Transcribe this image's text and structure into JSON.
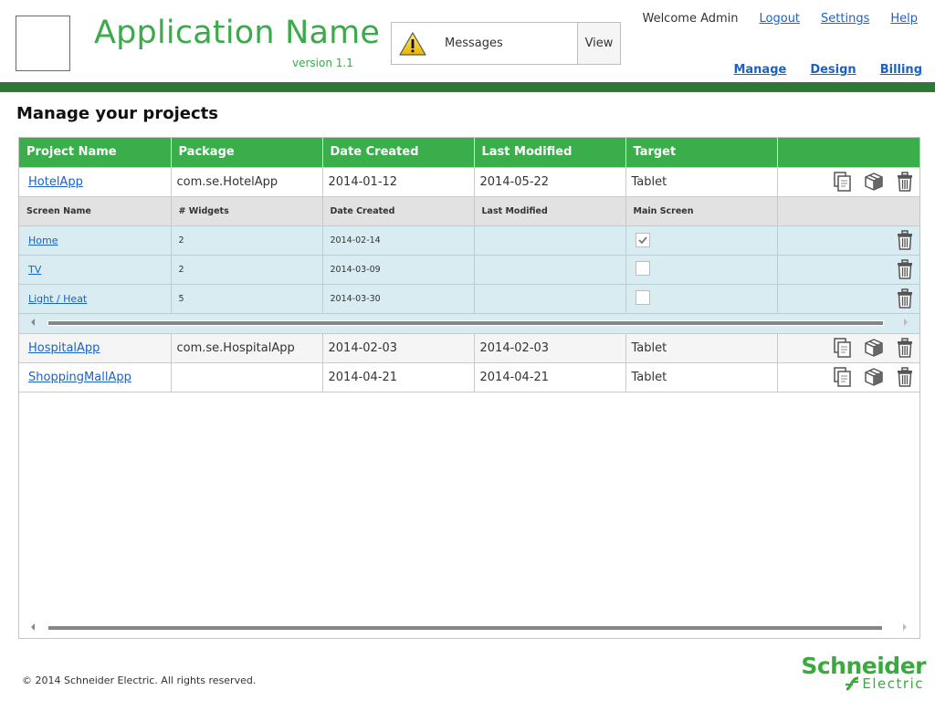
{
  "header": {
    "app_name": "Application Name",
    "version": "version 1.1",
    "messages": {
      "label": "Messages",
      "view_label": "View",
      "icon": "warning-icon"
    },
    "welcome": "Welcome Admin",
    "user_links": [
      "Logout",
      "Settings",
      "Help"
    ],
    "nav": [
      "Manage",
      "Design",
      "Billing"
    ]
  },
  "page": {
    "title": "Manage your projects"
  },
  "projects_table": {
    "columns": [
      "Project Name",
      "Package",
      "Date Created",
      "Last Modified",
      "Target",
      ""
    ],
    "row_actions": [
      "copy-icon",
      "package-icon",
      "trash-icon"
    ],
    "rows": [
      {
        "name": "HotelApp",
        "package": "com.se.HotelApp",
        "date_created": "2014-01-12",
        "last_modified": "2014-05-22",
        "target": "Tablet",
        "expanded": true,
        "screens": {
          "columns": [
            "Screen Name",
            "# Widgets",
            "Date Created",
            "Last Modified",
            "Main Screen",
            ""
          ],
          "rows": [
            {
              "name": "Home",
              "widgets": "2",
              "date_created": "2014-02-14",
              "last_modified": "",
              "main_screen": true
            },
            {
              "name": "TV",
              "widgets": "2",
              "date_created": "2014-03-09",
              "last_modified": "",
              "main_screen": false
            },
            {
              "name": "Light / Heat",
              "widgets": "5",
              "date_created": "2014-03-30",
              "last_modified": "",
              "main_screen": false
            }
          ]
        }
      },
      {
        "name": "HospitalApp",
        "package": "com.se.HospitalApp",
        "date_created": "2014-02-03",
        "last_modified": "2014-02-03",
        "target": "Tablet"
      },
      {
        "name": "ShoppingMallApp",
        "package": "",
        "date_created": "2014-04-21",
        "last_modified": "2014-04-21",
        "target": "Tablet"
      }
    ]
  },
  "footer": {
    "copyright": "© 2014 Schneider Electric. All rights reserved.",
    "brand_top": "Schneider",
    "brand_bottom": "Electric"
  },
  "colors": {
    "brand_green": "#3aaa4a",
    "header_bar": "#2b7a31",
    "table_header": "#3aae4b",
    "sub_row": "#d8ecf1",
    "link": "#1a62c4"
  }
}
